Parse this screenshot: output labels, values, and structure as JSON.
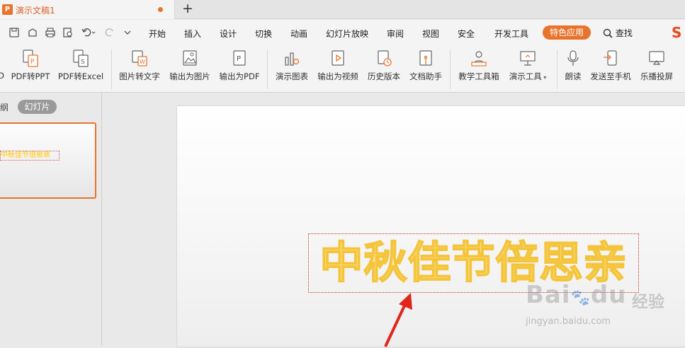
{
  "titlebar": {
    "doc_title": "演示文稿1",
    "new_tab_symbol": "+"
  },
  "menubar": {
    "items": [
      "开始",
      "插入",
      "设计",
      "切换",
      "动画",
      "幻灯片放映",
      "审阅",
      "视图",
      "安全",
      "开发工具"
    ],
    "special": "特色应用",
    "search": "查找",
    "accent": "#e8732c"
  },
  "toolbar": {
    "tools": [
      {
        "label": "D",
        "icon": "pdf-partial-icon"
      },
      {
        "label": "PDF转PPT",
        "icon": "pdf-to-ppt-icon"
      },
      {
        "label": "PDF转Excel",
        "icon": "pdf-to-excel-icon"
      },
      {
        "label": "图片转文字",
        "icon": "image-to-text-icon"
      },
      {
        "label": "输出为图片",
        "icon": "export-image-icon"
      },
      {
        "label": "输出为PDF",
        "icon": "export-pdf-icon"
      },
      {
        "label": "演示图表",
        "icon": "chart-icon"
      },
      {
        "label": "输出为视频",
        "icon": "export-video-icon"
      },
      {
        "label": "历史版本",
        "icon": "history-icon"
      },
      {
        "label": "文档助手",
        "icon": "doc-assistant-icon"
      },
      {
        "label": "教学工具箱",
        "icon": "teaching-tools-icon"
      },
      {
        "label": "演示工具",
        "icon": "presentation-tools-icon"
      },
      {
        "label": "朗读",
        "icon": "microphone-icon"
      },
      {
        "label": "发送至手机",
        "icon": "send-to-phone-icon"
      },
      {
        "label": "乐播投屏",
        "icon": "screen-cast-icon"
      }
    ]
  },
  "leftpanel": {
    "outline_tab": "纲",
    "slides_tab": "幻灯片",
    "thumb_text": "中秋佳节倍思亲"
  },
  "slide": {
    "title": "中秋佳节倍思亲",
    "title_color": "#ffe69a",
    "outline_color": "#f4c53c"
  },
  "watermark": {
    "brand": "Bai",
    "brand2": "du",
    "jingyan": "经验",
    "url": "jingyan.baidu.com"
  }
}
